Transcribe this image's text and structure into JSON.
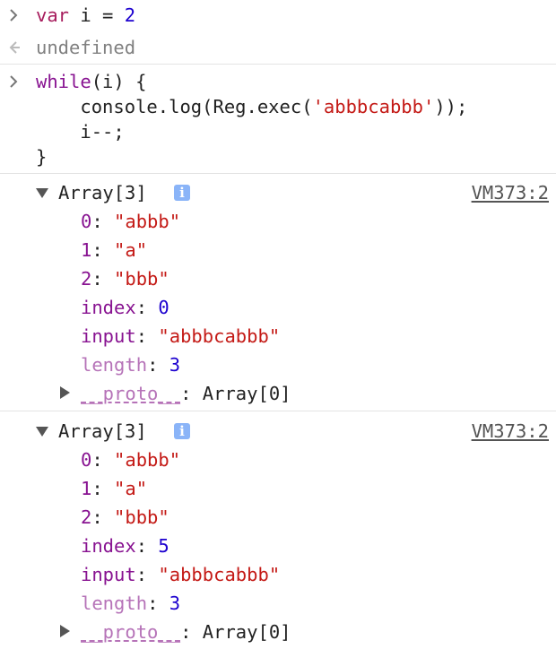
{
  "console": {
    "entry1": {
      "code": {
        "kw": "var",
        "ident": " i = ",
        "num": "2"
      },
      "result": "undefined"
    },
    "entry2": {
      "line1": {
        "kw": "while",
        "rest": "(i) {"
      },
      "line2": {
        "pre": "    console.log(Reg.exec(",
        "str": "'abbbcabbb'",
        "post": "));"
      },
      "line3": "    i--;",
      "line4": "}"
    },
    "log_source": "VM373:2",
    "arrays": [
      {
        "header": "Array[3]",
        "items": [
          {
            "key": "0",
            "value": "\"abbb\""
          },
          {
            "key": "1",
            "value": "\"a\""
          },
          {
            "key": "2",
            "value": "\"bbb\""
          }
        ],
        "index_key": "index",
        "index_value": "0",
        "input_key": "input",
        "input_value": "\"abbbcabbb\"",
        "length_key": "length",
        "length_value": "3",
        "proto_key": "__proto__",
        "proto_value": "Array[0]"
      },
      {
        "header": "Array[3]",
        "items": [
          {
            "key": "0",
            "value": "\"abbb\""
          },
          {
            "key": "1",
            "value": "\"a\""
          },
          {
            "key": "2",
            "value": "\"bbb\""
          }
        ],
        "index_key": "index",
        "index_value": "5",
        "input_key": "input",
        "input_value": "\"abbbcabbb\"",
        "length_key": "length",
        "length_value": "3",
        "proto_key": "__proto__",
        "proto_value": "Array[0]"
      }
    ],
    "colors": {
      "keyword": "#a71d5d",
      "number": "#1c00cf",
      "string": "#c41a16",
      "property": "#881391",
      "undefined": "#808080"
    }
  }
}
